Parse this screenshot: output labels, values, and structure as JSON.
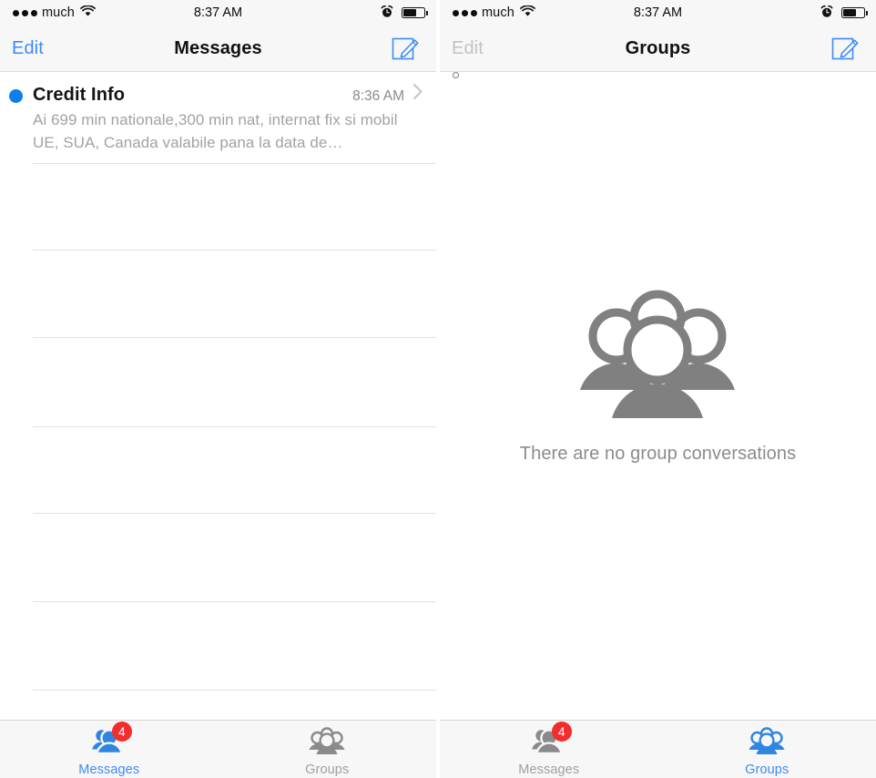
{
  "colors": {
    "accent_blue": "#3e8bf5",
    "unread_dot": "#0b7ff0",
    "badge_red": "#f22d2d",
    "inactive_grey": "#a0a0a0",
    "icon_grey": "#808080",
    "nav_bg": "#f7f7f7"
  },
  "left_panel": {
    "status_bar": {
      "signal_filled": 3,
      "signal_total": 5,
      "carrier": "much",
      "wifi_icon": "wifi-icon",
      "time": "8:37 AM",
      "alarm_icon": "alarm-clock-icon",
      "battery_icon": "battery-icon",
      "battery_percent": 60
    },
    "nav": {
      "edit_label": "Edit",
      "edit_enabled": true,
      "title": "Messages",
      "compose_icon": "compose-icon"
    },
    "conversations": [
      {
        "unread": true,
        "title": "Credit Info",
        "time": "8:36 AM",
        "preview": "Ai 699 min nationale,300 min nat, internat fix si mobil UE, SUA, Canada valabile pana la data de…",
        "chevron_icon": "chevron-right-icon"
      }
    ],
    "separator_positions": [
      179,
      274,
      370,
      468,
      563,
      660,
      757
    ],
    "tabs": [
      {
        "label": "Messages",
        "icon": "two-people-icon",
        "active": true,
        "badge": "4"
      },
      {
        "label": "Groups",
        "icon": "group-people-icon",
        "active": false,
        "badge": null
      }
    ]
  },
  "right_panel": {
    "status_bar": {
      "signal_filled": 3,
      "signal_total": 5,
      "carrier": "much",
      "wifi_icon": "wifi-icon",
      "time": "8:37 AM",
      "alarm_icon": "alarm-clock-icon",
      "battery_icon": "battery-icon",
      "battery_percent": 60
    },
    "nav": {
      "edit_label": "Edit",
      "edit_enabled": false,
      "title": "Groups",
      "compose_icon": "compose-icon"
    },
    "empty_state": {
      "icon": "group-people-icon",
      "message": "There are no group conversations"
    },
    "tabs": [
      {
        "label": "Messages",
        "icon": "two-people-icon",
        "active": false,
        "badge": "4"
      },
      {
        "label": "Groups",
        "icon": "group-people-icon",
        "active": true,
        "badge": null
      }
    ]
  }
}
